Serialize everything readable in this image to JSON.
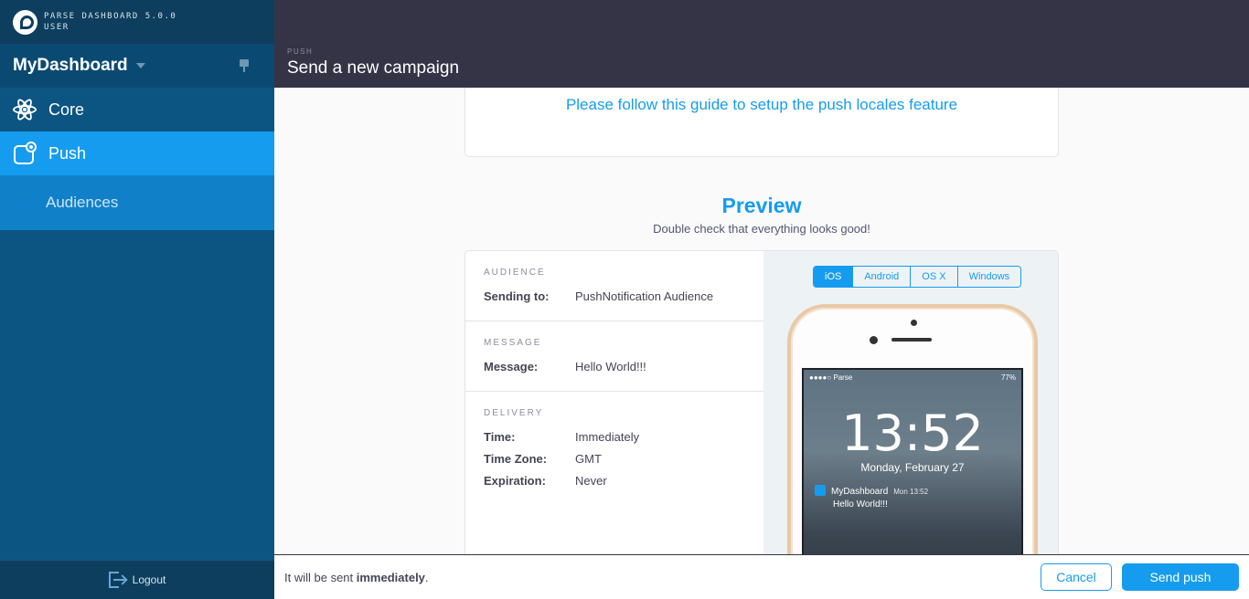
{
  "brand": {
    "line1": "PARSE DASHBOARD 5.0.0",
    "line2": "USER"
  },
  "app": {
    "name": "MyDashboard"
  },
  "nav": {
    "core": "Core",
    "push": "Push",
    "audiences": "Audiences",
    "logout": "Logout"
  },
  "header": {
    "section": "PUSH",
    "title": "Send a new campaign"
  },
  "locales": {
    "link": "Please follow this guide to setup the push locales feature"
  },
  "preview": {
    "title": "Preview",
    "subtitle": "Double check that everything looks good!",
    "audience": {
      "heading": "AUDIENCE",
      "key": "Sending to:",
      "value": "PushNotification Audience"
    },
    "message": {
      "heading": "MESSAGE",
      "key": "Message:",
      "value": "Hello World!!!"
    },
    "delivery": {
      "heading": "DELIVERY",
      "rows": [
        {
          "key": "Time:",
          "value": "Immediately"
        },
        {
          "key": "Time Zone:",
          "value": "GMT"
        },
        {
          "key": "Expiration:",
          "value": "Never"
        }
      ]
    },
    "tabs": [
      "iOS",
      "Android",
      "OS X",
      "Windows"
    ],
    "active_tab": "iOS",
    "phone": {
      "carrier": "●●●●○ Parse",
      "battery": "77%",
      "clock": "13:52",
      "date": "Monday, February 27",
      "notif_app": "MyDashboard",
      "notif_time": "Mon 13:52",
      "notif_msg": "Hello World!!!"
    }
  },
  "footer": {
    "note_prefix": "It will be sent ",
    "note_bold": "immediately",
    "note_suffix": ".",
    "cancel": "Cancel",
    "send": "Send push"
  },
  "colors": {
    "accent": "#169cee",
    "sidebar": "#0c5582",
    "header": "#353446"
  }
}
